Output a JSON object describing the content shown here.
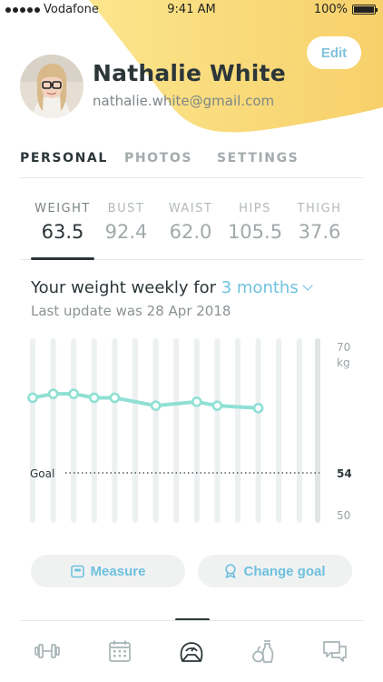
{
  "status_bar": {
    "carrier": "Vodafone",
    "time": "9:41 AM",
    "battery": "100%"
  },
  "profile": {
    "name": "Nathalie White",
    "email": "nathalie.white@gmail.com",
    "edit_label": "Edit",
    "accent_color": "#f7d66f"
  },
  "tabs": [
    {
      "label": "PERSONAL",
      "active": true
    },
    {
      "label": "PHOTOS",
      "active": false
    },
    {
      "label": "SETTINGS",
      "active": false
    }
  ],
  "metrics": [
    {
      "label": "WEIGHT",
      "value": "63.5",
      "active": true
    },
    {
      "label": "BUST",
      "value": "92.4",
      "active": false
    },
    {
      "label": "WAIST",
      "value": "62.0",
      "active": false
    },
    {
      "label": "HIPS",
      "value": "105.5",
      "active": false
    },
    {
      "label": "THIGH",
      "value": "37.6",
      "active": false
    }
  ],
  "chart_header": {
    "title_prefix": "Your weight weekly for",
    "range": "3 months",
    "subtitle": "Last update was 28 Apr 2018"
  },
  "chart_data": {
    "type": "line",
    "x": [
      1,
      2,
      3,
      4,
      5,
      6,
      7,
      8,
      9,
      10,
      11,
      12,
      13,
      14
    ],
    "series": [
      {
        "values": [
          63.5,
          64,
          64,
          63.5,
          63.5,
          null,
          62.5,
          null,
          63,
          62.5,
          null,
          62.2,
          null,
          null
        ]
      }
    ],
    "goal": 54,
    "goal_label": "Goal",
    "y_ticks": [
      "70",
      "54",
      "50"
    ],
    "y_unit": "kg",
    "ylim": [
      50,
      70
    ],
    "line_color": "#8fe0d4"
  },
  "actions": {
    "measure": "Measure",
    "change_goal": "Change goal"
  },
  "bottom_nav": [
    {
      "icon": "dumbbell-icon",
      "active": false
    },
    {
      "icon": "calendar-icon",
      "active": false
    },
    {
      "icon": "scale-icon",
      "active": true
    },
    {
      "icon": "food-icon",
      "active": false
    },
    {
      "icon": "chat-icon",
      "active": false
    }
  ]
}
